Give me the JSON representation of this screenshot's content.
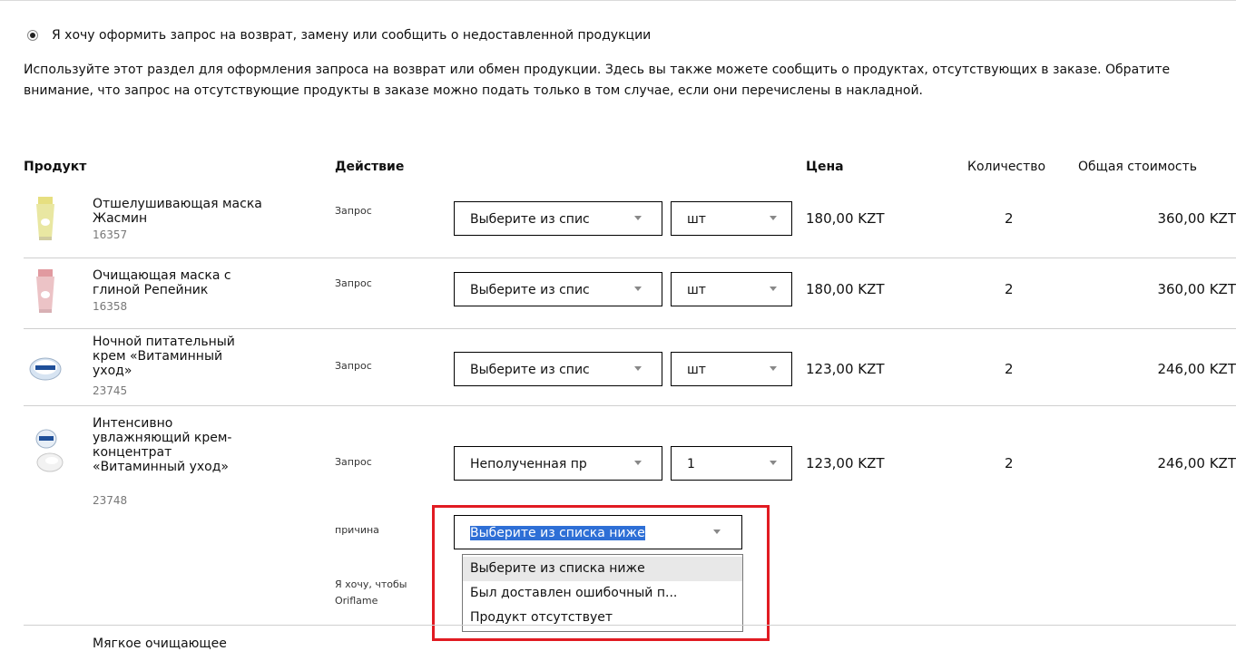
{
  "option": {
    "label": "Я хочу оформить запрос на возврат, замену или сообщить о недоставленной продукции",
    "selected": true
  },
  "intro": "Используйте этот раздел для оформления запроса на возврат или обмен продукции. Здесь вы также можете сообщить о продуктах, отсутствующих в заказе. Обратите внимание, что запрос на отсутствующие продукты в заказе можно подать только в том случае, если они перечислены в накладной.",
  "table": {
    "headers": {
      "product": "Продукт",
      "action": "Действие",
      "price": "Цена",
      "quantity": "Количество",
      "total": "Общая стоимость"
    },
    "rows": [
      {
        "name": "Отшелушивающая маска Жасмин",
        "code": "16357",
        "action_label": "Запрос",
        "select1": "Выберите из спис",
        "select2": "шт",
        "price": "180,00 KZT",
        "qty": "2",
        "total": "360,00 KZT"
      },
      {
        "name": "Очищающая маска с глиной Репейник",
        "code": "16358",
        "action_label": "Запрос",
        "select1": "Выберите из спис",
        "select2": "шт",
        "price": "180,00 KZT",
        "qty": "2",
        "total": "360,00 KZT"
      },
      {
        "name": "Ночной питательный крем «Витаминный уход»",
        "code": "23745",
        "action_label": "Запрос",
        "select1": "Выберите из спис",
        "select2": "шт",
        "price": "123,00 KZT",
        "qty": "2",
        "total": "246,00 KZT"
      },
      {
        "name": "Интенсивно увлажняющий крем-концентрат «Витаминный уход»",
        "code": "23748",
        "action_label": "Запрос",
        "select1": "Неполученная пр",
        "select2": "1",
        "price": "123,00 KZT",
        "qty": "2",
        "total": "246,00 KZT"
      }
    ],
    "partial_row_name": "Мягкое очищающее"
  },
  "reason": {
    "label": "причина",
    "selected": "Выберите из списка ниже",
    "note_line1": "Я хочу, чтобы",
    "note_line2": "Oriflame",
    "options": [
      "Выберите из списка ниже",
      "Был доставлен ошибочный п...",
      "Продукт отсутствует"
    ]
  },
  "colors": {
    "highlight_box": "#e11b22",
    "selection": "#2e6fd6"
  }
}
